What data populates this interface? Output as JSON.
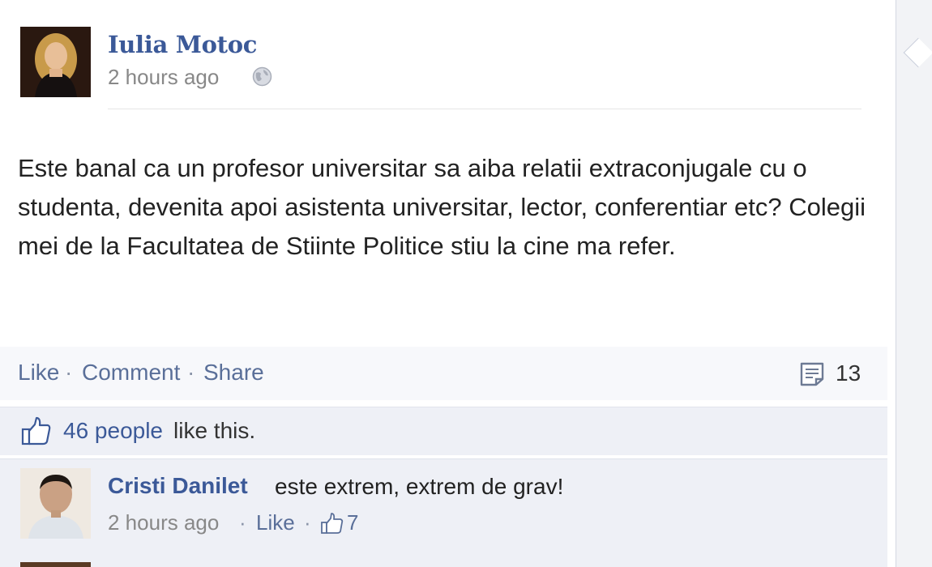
{
  "post": {
    "author": "Iulia Motoc",
    "time": "2 hours ago",
    "privacy_icon": "globe-icon",
    "text": "Este banal ca un profesor universitar sa aiba relatii extraconjugale cu o studenta, devenita apoi asistenta universitar, lector, conferentiar etc? Colegii mei de la Facultatea de Stiinte Politice stiu la cine ma refer."
  },
  "actions": {
    "like": "Like",
    "comment": "Comment",
    "share": "Share",
    "separator": "·",
    "comment_count": "13"
  },
  "likes": {
    "count_text": "46 people",
    "rest_text": "like this."
  },
  "comments": [
    {
      "author": "Cristi Danilet",
      "text": "este extrem, extrem de grav!",
      "time": "2 hours ago",
      "like_label": "Like",
      "like_count": "7"
    }
  ],
  "colors": {
    "link": "#3b5998",
    "muted": "#888888",
    "panel": "#eef0f6"
  }
}
